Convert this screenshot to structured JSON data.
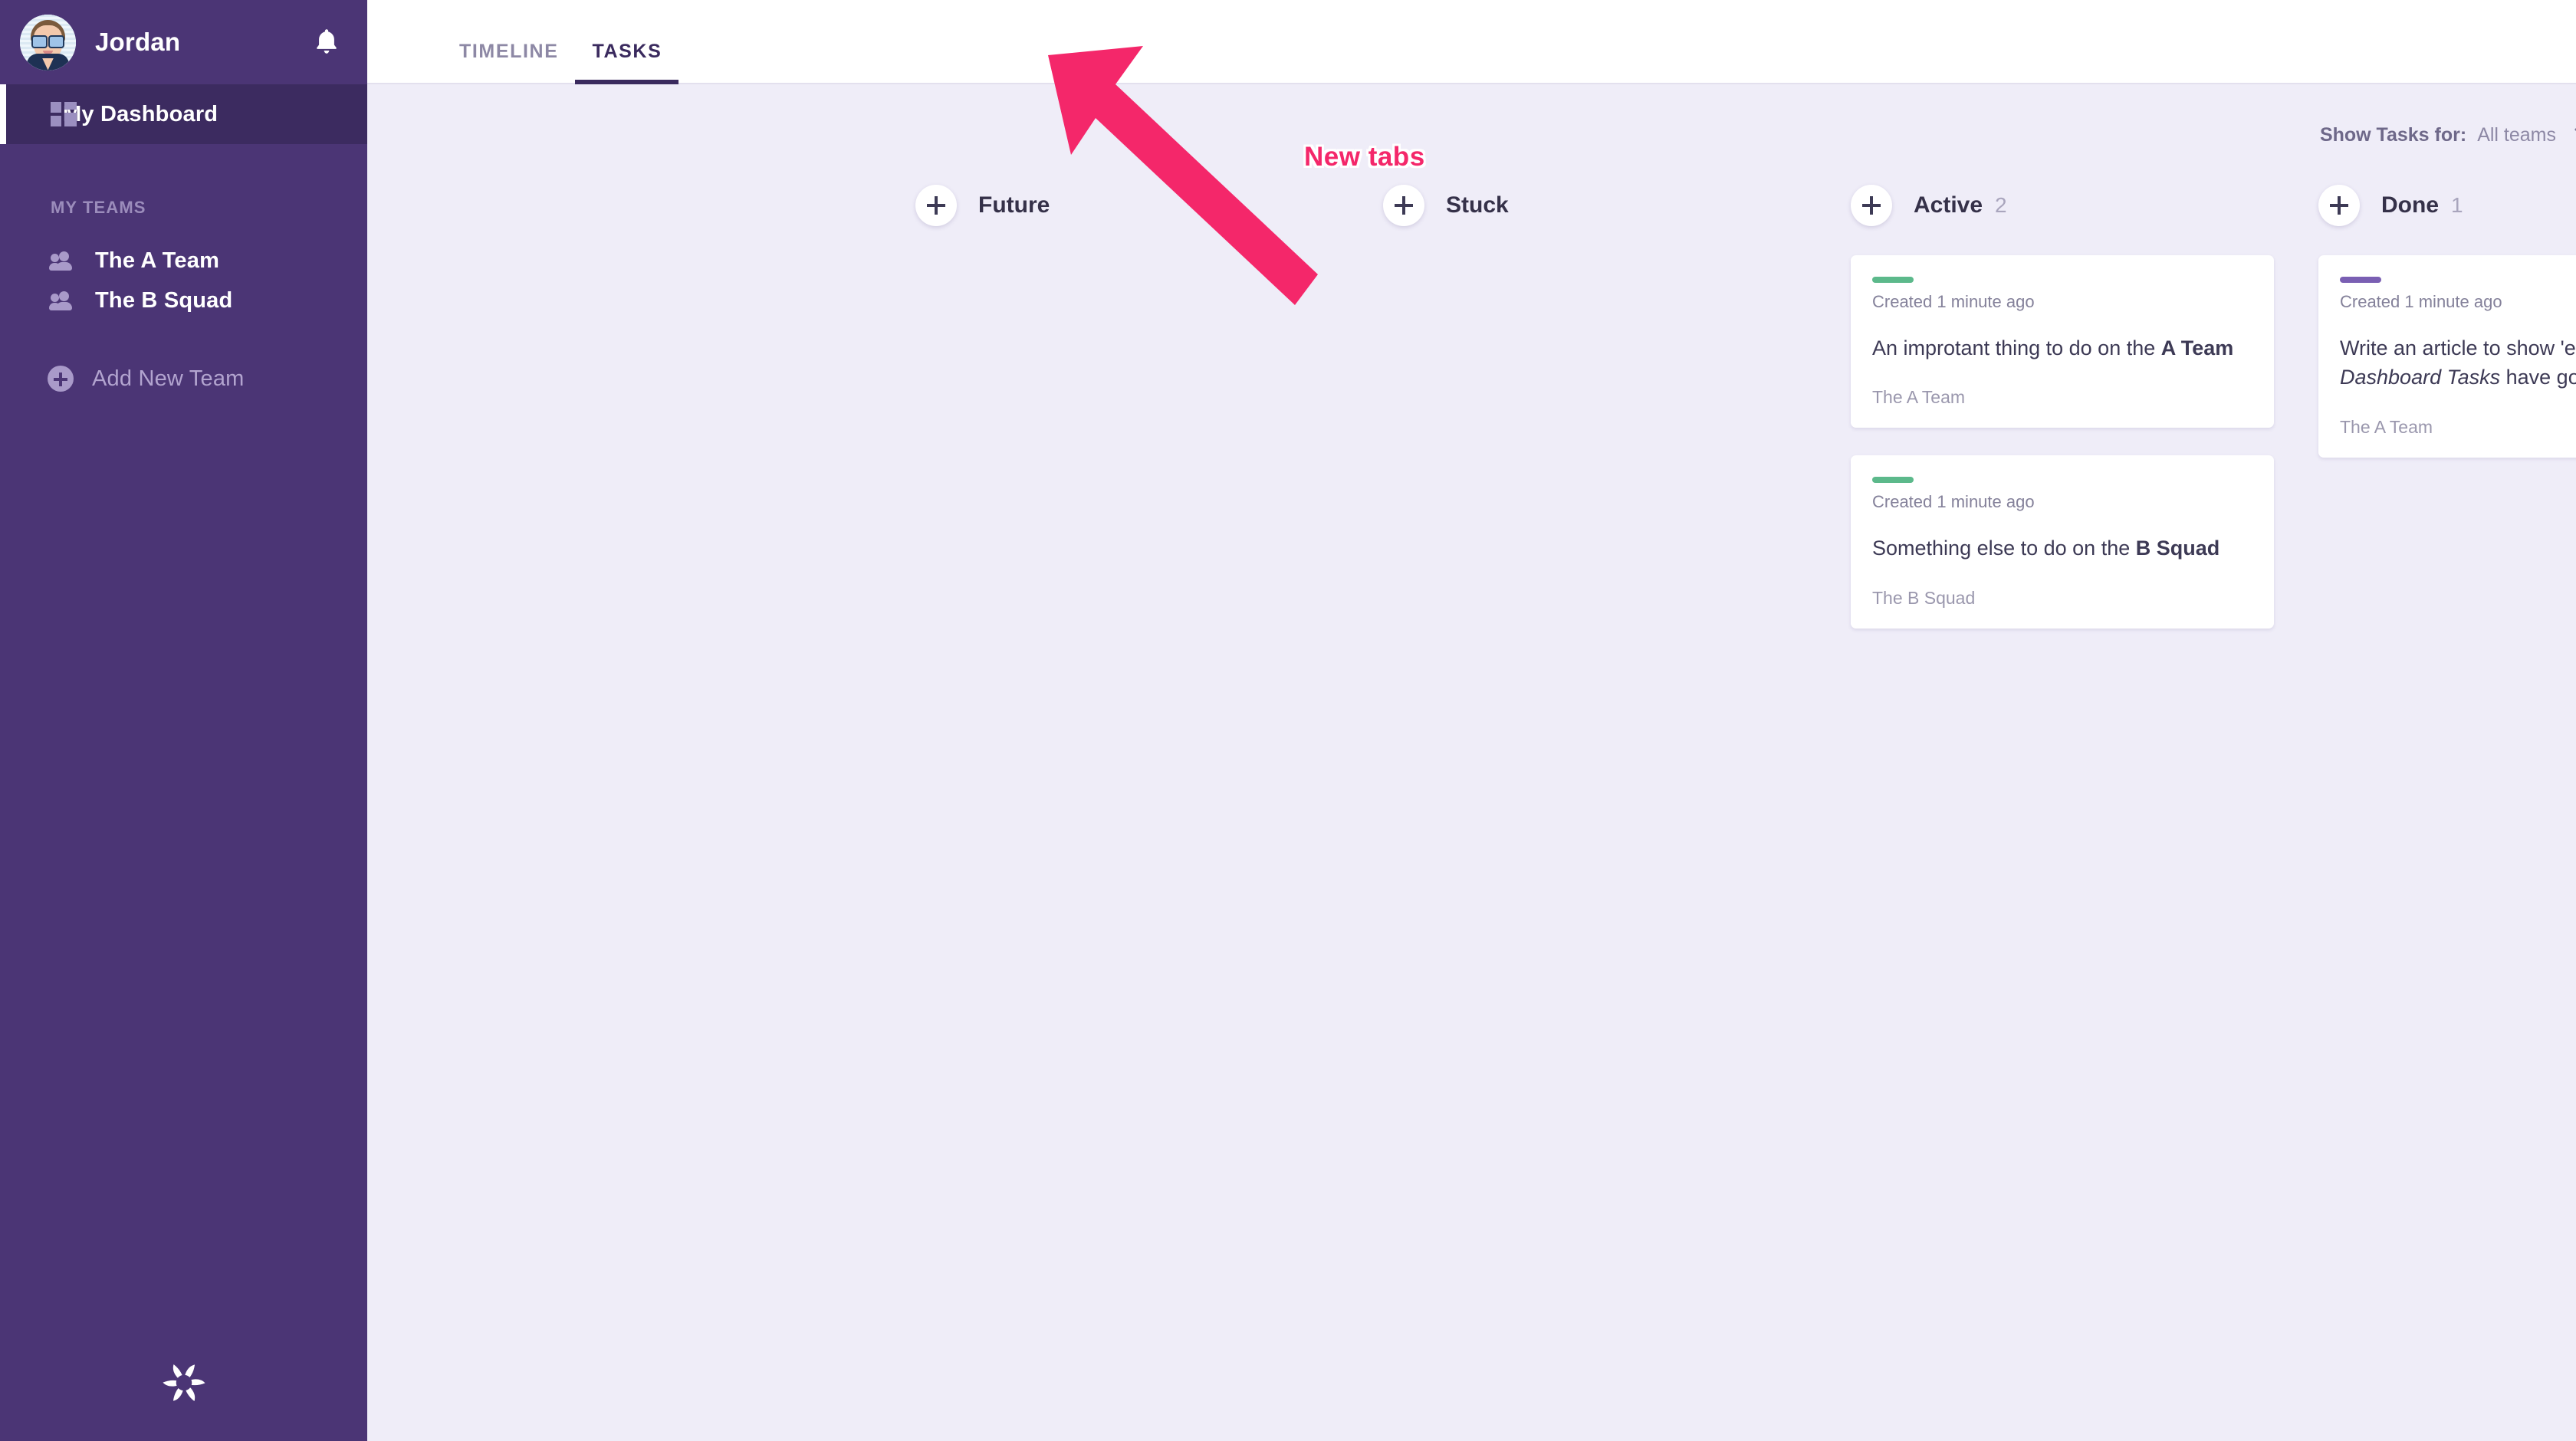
{
  "sidebar": {
    "username": "Jordan",
    "avatar_name": "user-avatar",
    "bell_icon": "bell-icon",
    "dashboard": {
      "label": "My Dashboard",
      "icon": "grid-icon"
    },
    "section_title": "MY TEAMS",
    "teams": [
      {
        "label": "The A Team",
        "icon": "people-icon"
      },
      {
        "label": "The B Squad",
        "icon": "people-icon"
      }
    ],
    "add_team": {
      "label": "Add New Team",
      "icon": "plus-circle-icon"
    },
    "logo_name": "app-logo"
  },
  "topbar": {
    "tabs": [
      {
        "label": "TIMELINE",
        "active": false
      },
      {
        "label": "TASKS",
        "active": true
      }
    ]
  },
  "filter": {
    "label": "Show Tasks for:",
    "value": "All teams",
    "chevron_icon": "chevron-down-icon"
  },
  "board": {
    "columns": [
      {
        "title": "Future",
        "count": "",
        "add_label": "+",
        "cards": []
      },
      {
        "title": "Stuck",
        "count": "",
        "add_label": "+",
        "cards": []
      },
      {
        "title": "Active",
        "count": "2",
        "add_label": "+",
        "cards": [
          {
            "bar_color": "#5cb98b",
            "created": "Created 1 minute ago",
            "title_plain_1": "An improtant thing to do on the ",
            "title_bold": "A Team",
            "title_plain_2": "",
            "team": "The A Team"
          },
          {
            "bar_color": "#5cb98b",
            "created": "Created 1 minute ago",
            "title_plain_1": "Something else to do on the ",
            "title_bold": "B Squad",
            "title_plain_2": "",
            "team": "The B Squad"
          }
        ]
      },
      {
        "title": "Done",
        "count": "1",
        "add_label": "+",
        "cards": [
          {
            "bar_color": "#7a5fb3",
            "created": "Created 1 minute ago",
            "title_plain_1": "Write an article to show 'em where ",
            "title_italic": "My Dashboard Tasks",
            "title_plain_2": " have gone to 🖊",
            "team": "The A Team"
          }
        ]
      }
    ]
  },
  "annotation": {
    "text": "New tabs",
    "arrow_name": "annotation-arrow",
    "color": "#f4276a"
  },
  "colors": {
    "sidebar_bg": "#4b3575",
    "sidebar_active_bg": "#3c2b60",
    "main_bg": "#efedf8",
    "tab_active": "#3a2a5e",
    "status_green": "#5cb98b",
    "status_purple": "#7a5fb3",
    "annotation_pink": "#f4276a"
  }
}
